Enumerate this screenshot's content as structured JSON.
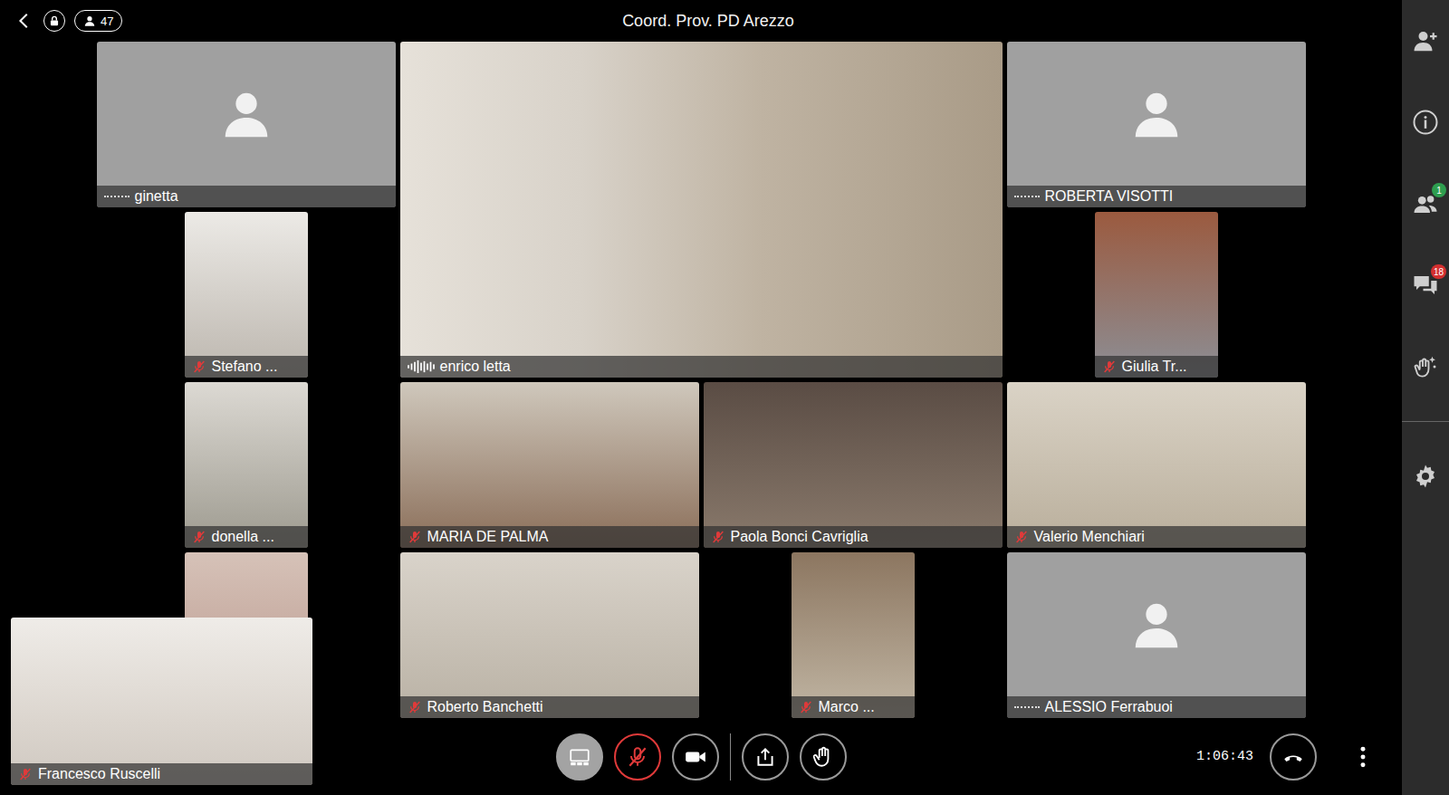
{
  "topbar": {
    "title": "Coord. Prov. PD Arezzo",
    "participant_count": "47"
  },
  "participants": [
    {
      "name": "ginetta",
      "video": false,
      "muted": false,
      "speaking": false
    },
    {
      "name": "enrico letta",
      "video": true,
      "muted": false,
      "speaking": true
    },
    {
      "name": "ROBERTA VISOTTI",
      "video": false,
      "muted": false,
      "speaking": false
    },
    {
      "name": "Stefano ...",
      "video": true,
      "muted": true,
      "speaking": false
    },
    {
      "name": "Giulia Tr...",
      "video": true,
      "muted": true,
      "speaking": false
    },
    {
      "name": "donella ...",
      "video": true,
      "muted": true,
      "speaking": false
    },
    {
      "name": "MARIA DE PALMA",
      "video": true,
      "muted": true,
      "speaking": false
    },
    {
      "name": "Paola Bonci Cavriglia",
      "video": true,
      "muted": true,
      "speaking": false
    },
    {
      "name": "Valerio Menchiari",
      "video": true,
      "muted": true,
      "speaking": false
    },
    {
      "name": "",
      "video": true,
      "muted": false,
      "speaking": false
    },
    {
      "name": "Roberto Banchetti",
      "video": true,
      "muted": true,
      "speaking": false
    },
    {
      "name": "Marco ...",
      "video": true,
      "muted": true,
      "speaking": false
    },
    {
      "name": "ALESSIO  Ferrabuoi",
      "video": false,
      "muted": false,
      "speaking": false
    }
  ],
  "self_view": {
    "name": "Francesco Ruscelli",
    "muted": true
  },
  "controls": [
    {
      "kind": "layout",
      "selected": true,
      "muted": false
    },
    {
      "kind": "mic",
      "selected": false,
      "muted": true
    },
    {
      "kind": "camera",
      "selected": false,
      "muted": false
    },
    {
      "kind": "share",
      "selected": false,
      "muted": false
    },
    {
      "kind": "hand",
      "selected": false,
      "muted": false
    }
  ],
  "timer": "1:06:43",
  "sidebar": [
    {
      "kind": "add-person",
      "badge": "",
      "badge_color": ""
    },
    {
      "kind": "info",
      "badge": "",
      "badge_color": ""
    },
    {
      "kind": "participants",
      "badge": "1",
      "badge_color": "#2e9e4f"
    },
    {
      "kind": "chat",
      "badge": "18",
      "badge_color": "#d32f2f"
    },
    {
      "kind": "effects",
      "badge": "",
      "badge_color": ""
    },
    {
      "kind": "settings",
      "badge": "",
      "badge_color": ""
    }
  ]
}
